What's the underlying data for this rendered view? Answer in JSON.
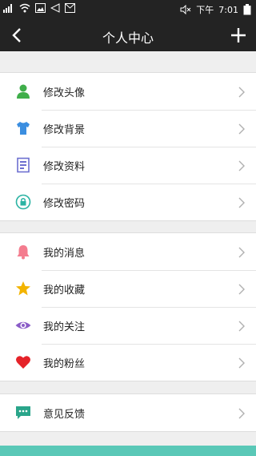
{
  "status_bar": {
    "signal": "ııll",
    "time": "7:01",
    "period": "下午",
    "icons": [
      "signal-icon",
      "wifi-icon",
      "image-icon",
      "send-icon",
      "mail-icon",
      "mute-icon",
      "battery-icon"
    ]
  },
  "header": {
    "title": "个人中心",
    "back_icon": "back-arrow-icon",
    "add_icon": "plus-icon"
  },
  "groups": [
    {
      "items": [
        {
          "label": "修改头像",
          "icon": "person-icon",
          "color": "#3fae4a"
        },
        {
          "label": "修改背景",
          "icon": "shirt-icon",
          "color": "#3b8ee0"
        },
        {
          "label": "修改资料",
          "icon": "document-icon",
          "color": "#6d6fd0"
        },
        {
          "label": "修改密码",
          "icon": "lock-icon",
          "color": "#2bb3a3"
        }
      ]
    },
    {
      "items": [
        {
          "label": "我的消息",
          "icon": "bell-icon",
          "color": "#f47c8e"
        },
        {
          "label": "我的收藏",
          "icon": "star-icon",
          "color": "#f3b400"
        },
        {
          "label": "我的关注",
          "icon": "eye-icon",
          "color": "#8a5cc7"
        },
        {
          "label": "我的粉丝",
          "icon": "heart-icon",
          "color": "#e52329"
        }
      ]
    },
    {
      "items": [
        {
          "label": "意见反馈",
          "icon": "chat-icon",
          "color": "#2aa58a"
        }
      ]
    }
  ],
  "colors": {
    "header_bg": "#232323",
    "page_bg": "#efefef",
    "accent_bottom": "#5ac8b7"
  }
}
